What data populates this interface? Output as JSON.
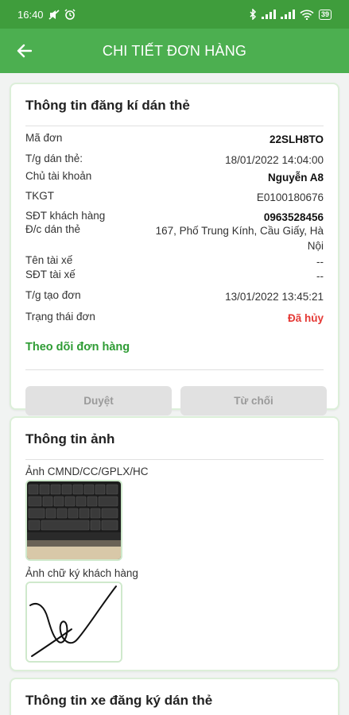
{
  "status_bar": {
    "time": "16:40",
    "battery": "39"
  },
  "header": {
    "title": "CHI TIẾT ĐƠN HÀNG"
  },
  "registration": {
    "title": "Thông tin đăng kí dán thẻ",
    "rows": [
      {
        "label": "Mã đơn",
        "value": "22SLH8TO"
      },
      {
        "label": "T/g dán thẻ:",
        "value": "18/01/2022 14:04:00"
      },
      {
        "label": "Chủ tài khoản",
        "value": "Nguyễn A8"
      },
      {
        "label": "TKGT",
        "value": "E0100180676"
      },
      {
        "label": "SĐT khách hàng",
        "value": "0963528456"
      },
      {
        "label": "Đ/c dán thẻ",
        "value": "167, Phố Trung Kính, Cầu Giấy, Hà Nội"
      },
      {
        "label": "Tên tài xế",
        "value": "--"
      },
      {
        "label": "SĐT tài xế",
        "value": "--"
      },
      {
        "label": "T/g tạo đơn",
        "value": "13/01/2022 13:45:21"
      },
      {
        "label": "Trạng thái đơn",
        "value": "Đã hủy"
      }
    ],
    "track_link": "Theo dõi đơn hàng",
    "approve_label": "Duyệt",
    "reject_label": "Từ chối"
  },
  "images": {
    "title": "Thông tin ảnh",
    "id_label": "Ảnh CMND/CC/GPLX/HC",
    "signature_label": "Ảnh chữ ký khách hàng"
  },
  "vehicle": {
    "title": "Thông tin xe đăng ký dán thẻ"
  },
  "colors": {
    "primary": "#4caf50",
    "status_bar": "#3f9d3c",
    "cancelled": "#e53935",
    "link": "#2e9c34"
  }
}
